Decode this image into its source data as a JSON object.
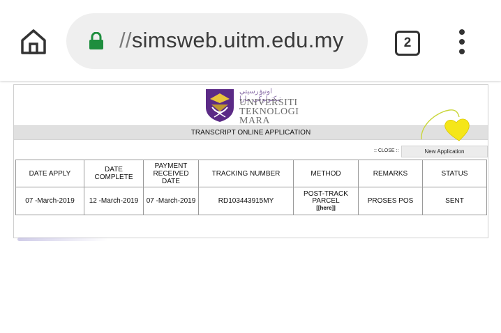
{
  "browser": {
    "url_prefix": "//",
    "url_host": "simsweb.uitm.edu.my",
    "tab_count": "2"
  },
  "logo": {
    "jawi": "اونيۏرسيتي تيکنولوڬي مارا",
    "line1": "UNIVERSITI",
    "line2": "TEKNOLOGI",
    "line3": "MARA"
  },
  "page": {
    "heading": "TRANSCRIPT ONLINE APPLICATION",
    "close_label": ":: CLOSE ::",
    "new_application_label": "New Application"
  },
  "table": {
    "headers": {
      "date_apply": "DATE APPLY",
      "date_complete": "DATE COMPLETE",
      "payment_line1": "PAYMENT",
      "payment_line2": "RECEIVED DATE",
      "tracking": "TRACKING NUMBER",
      "method": "METHOD",
      "remarks": "REMARKS",
      "status": "STATUS"
    },
    "row": {
      "date_apply": "07 -March-2019",
      "date_complete": "12 -March-2019",
      "payment_date": "07 -March-2019",
      "tracking": "RD103443915MY",
      "method": "POST-TRACK PARCEL",
      "method_link": "[[here]]",
      "remarks": "PROSES POS",
      "status": "SENT"
    }
  },
  "colors": {
    "lock": "#1e8e3e",
    "heart": "#f5e619",
    "crest": "#5b2a86"
  }
}
